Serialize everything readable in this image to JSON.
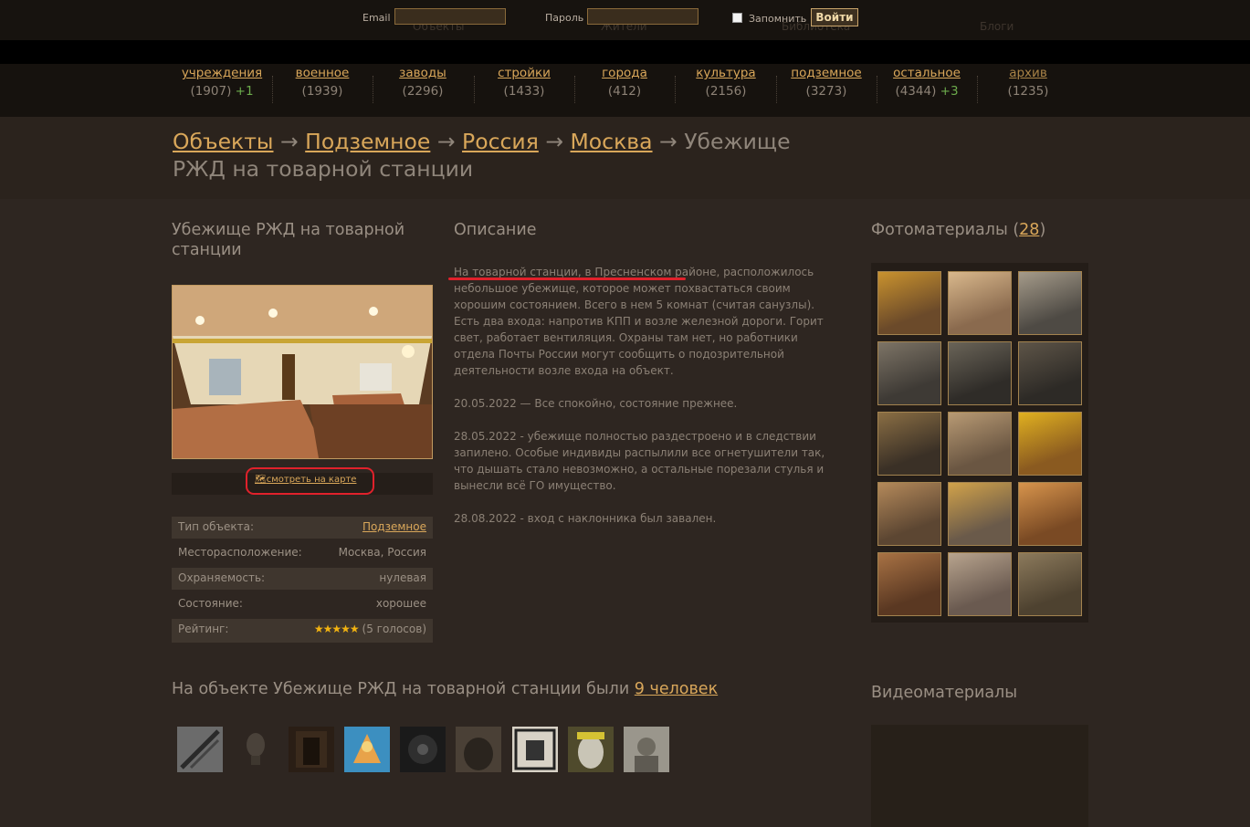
{
  "top": {
    "ghost_links": [
      "Объекты",
      "Жители",
      "Библиотека",
      "Блоги"
    ],
    "email_label": "Email",
    "password_label": "Пароль",
    "remember_label": "Запомнить",
    "login_button": "Войти"
  },
  "categories": [
    {
      "name": "учреждения",
      "count": "(1907)",
      "plus": "+1"
    },
    {
      "name": "военное",
      "count": "(1939)",
      "plus": ""
    },
    {
      "name": "заводы",
      "count": "(2296)",
      "plus": ""
    },
    {
      "name": "стройки",
      "count": "(1433)",
      "plus": ""
    },
    {
      "name": "города",
      "count": "(412)",
      "plus": ""
    },
    {
      "name": "культура",
      "count": "(2156)",
      "plus": ""
    },
    {
      "name": "подземное",
      "count": "(3273)",
      "plus": ""
    },
    {
      "name": "остальное",
      "count": "(4344)",
      "plus": "+3"
    },
    {
      "name": "архив",
      "count": "(1235)",
      "plus": ""
    }
  ],
  "breadcrumb": {
    "items": [
      "Объекты",
      "Подземное",
      "Россия",
      "Москва"
    ],
    "arrow": "→",
    "current": "Убежище РЖД на товарной станции"
  },
  "object": {
    "title": "Убежище РЖД на товарной станции",
    "map_link": "смотреть на карте",
    "props": [
      {
        "key": "Тип объекта:",
        "value": "Подземное"
      },
      {
        "key": "Месторасположение:",
        "value": "Москва, Россия"
      },
      {
        "key": "Охраняемость:",
        "value": "нулевая"
      },
      {
        "key": "Состояние:",
        "value": "хорошее"
      },
      {
        "key": "Рейтинг:",
        "value": "(5 голосов)",
        "stars": "★★★★★"
      }
    ]
  },
  "description": {
    "heading": "Описание",
    "highlight": "На товарной станции, в Пресненском районе",
    "p1_rest": ", расположилось небольшое убежище, которое может похвастаться своим хорошим состоянием. Всего в нем 5 комнат (считая санузлы). Есть два входа: напротив КПП и возле железной дороги. Горит свет, работает вентиляция. Охраны там нет, но работники отдела Почты России могут сообщить о подозрительной деятельности возле входа на объект.",
    "p2": "20.05.2022 — Все спокойно, состояние прежнее.",
    "p3": "28.05.2022 - убежище полностью раздестроено и в следствии запилено. Особые индивиды распылили все огнетушители так, что дышать стало невозможно, а остальные порезали стулья и вынесли всё ГО имущество.",
    "p4": "28.08.2022 - вход с наклонника был завален."
  },
  "photos": {
    "heading": "Фотоматериалы",
    "count": "28"
  },
  "visitors": {
    "text": "На объекте Убежище РЖД на товарной станции были",
    "count_link": "9 человек"
  },
  "videos": {
    "heading": "Видеоматериалы"
  },
  "colors": {
    "accent": "#d9a75a",
    "background": "#2e2621",
    "green": "#6cab4c",
    "annotation_red": "#e0212b"
  }
}
